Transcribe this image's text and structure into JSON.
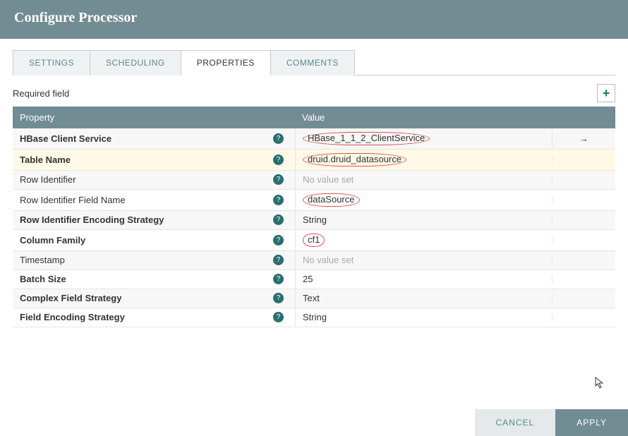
{
  "header": {
    "title": "Configure Processor"
  },
  "tabs": [
    {
      "label": "SETTINGS",
      "active": false
    },
    {
      "label": "SCHEDULING",
      "active": false
    },
    {
      "label": "PROPERTIES",
      "active": true
    },
    {
      "label": "COMMENTS",
      "active": false
    }
  ],
  "required_label": "Required field",
  "add_glyph": "+",
  "columns": {
    "property": "Property",
    "value": "Value"
  },
  "rows": [
    {
      "name": "HBase Client Service",
      "bold": true,
      "value": "HBase_1_1_2_ClientService",
      "circled": true,
      "placeholder": false,
      "highlight": false,
      "goto": true
    },
    {
      "name": "Table Name",
      "bold": true,
      "value": "druid.druid_datasource",
      "circled": true,
      "placeholder": false,
      "highlight": true,
      "goto": false
    },
    {
      "name": "Row Identifier",
      "bold": false,
      "value": "No value set",
      "circled": false,
      "placeholder": true,
      "highlight": false,
      "goto": false
    },
    {
      "name": "Row Identifier Field Name",
      "bold": false,
      "value": "dataSource",
      "circled": true,
      "placeholder": false,
      "highlight": false,
      "goto": false
    },
    {
      "name": "Row Identifier Encoding Strategy",
      "bold": true,
      "value": "String",
      "circled": false,
      "placeholder": false,
      "highlight": false,
      "goto": false
    },
    {
      "name": "Column Family",
      "bold": true,
      "value": "cf1",
      "circled": true,
      "placeholder": false,
      "highlight": false,
      "goto": false
    },
    {
      "name": "Timestamp",
      "bold": false,
      "value": "No value set",
      "circled": false,
      "placeholder": true,
      "highlight": false,
      "goto": false
    },
    {
      "name": "Batch Size",
      "bold": true,
      "value": "25",
      "circled": false,
      "placeholder": false,
      "highlight": false,
      "goto": false
    },
    {
      "name": "Complex Field Strategy",
      "bold": true,
      "value": "Text",
      "circled": false,
      "placeholder": false,
      "highlight": false,
      "goto": false
    },
    {
      "name": "Field Encoding Strategy",
      "bold": true,
      "value": "String",
      "circled": false,
      "placeholder": false,
      "highlight": false,
      "goto": false
    }
  ],
  "goto_glyph": "→",
  "help_glyph": "?",
  "buttons": {
    "cancel": "CANCEL",
    "apply": "APPLY"
  }
}
